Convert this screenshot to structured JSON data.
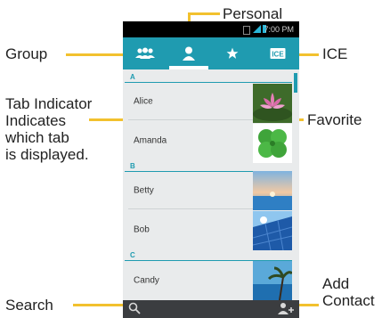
{
  "status_bar": {
    "time": "7:00 PM"
  },
  "tabs": [
    {
      "name": "Group",
      "icon": "group-icon"
    },
    {
      "name": "Personal",
      "icon": "person-icon"
    },
    {
      "name": "Favorite",
      "icon": "star-icon"
    },
    {
      "name": "ICE",
      "icon": "ice-icon"
    }
  ],
  "contacts": {
    "sections": [
      {
        "letter": "A",
        "entries": [
          "Alice",
          "Amanda"
        ]
      },
      {
        "letter": "B",
        "entries": [
          "Betty",
          "Bob"
        ]
      },
      {
        "letter": "C",
        "entries": [
          "Candy"
        ]
      }
    ],
    "ice_badge": "ICE"
  },
  "callouts": {
    "personal": "Personal",
    "group": "Group",
    "ice": "ICE",
    "tab_indicator": [
      "Tab Indicator",
      "Indicates",
      "which tab",
      "is displayed."
    ],
    "favorite": "Favorite",
    "search": "Search",
    "add_contact": [
      "Add",
      "Contact"
    ]
  },
  "colors": {
    "accent": "#1f9bb0",
    "callout_line": "#f2c12e",
    "bottom_bar": "#3b3d40"
  },
  "bottom_bar": {
    "left_icon": "search-icon",
    "right_icon": "add-contact-icon"
  }
}
